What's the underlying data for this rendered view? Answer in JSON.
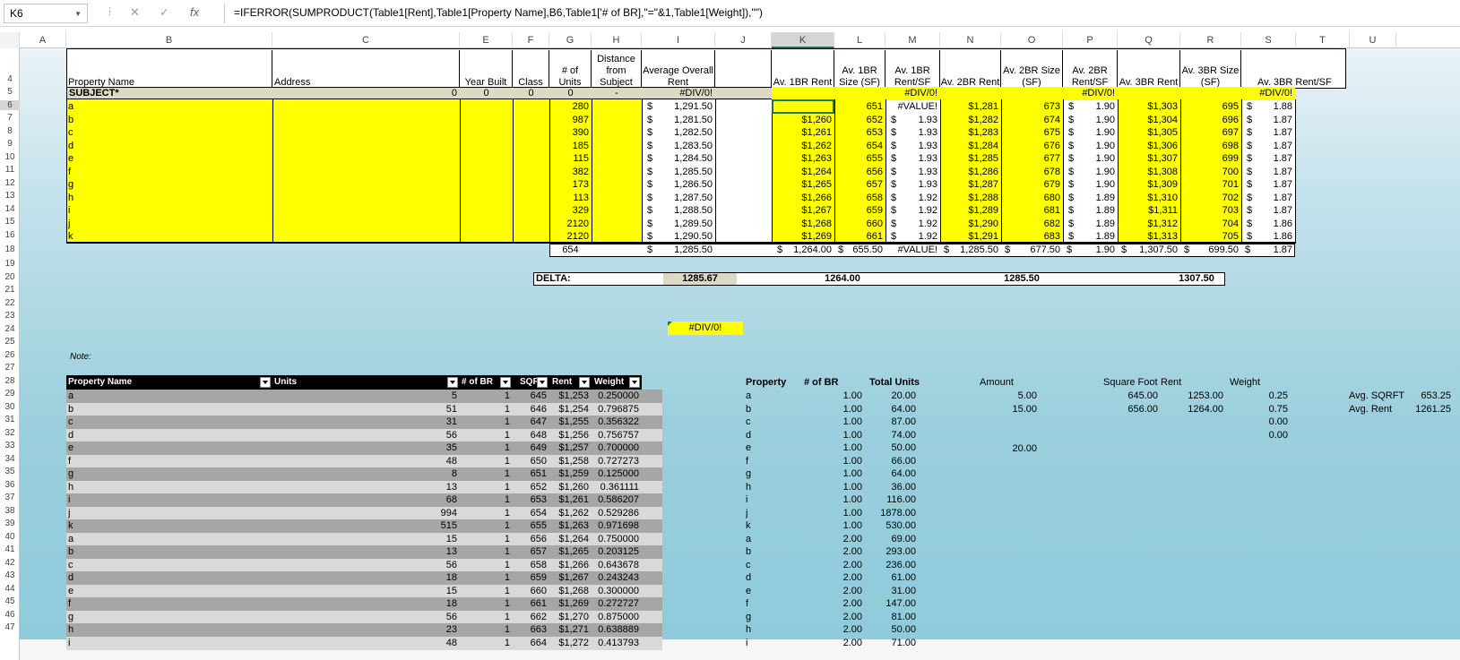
{
  "formula_bar": {
    "name_box": "K6",
    "formula": "=IFERROR(SUMPRODUCT(Table1[Rent],Table1[Property Name],B6,Table1['# of BR],\"=\"&1,Table1[Weight]),\"\")"
  },
  "columns": [
    "A",
    "B",
    "C",
    "E",
    "F",
    "G",
    "H",
    "I",
    "J",
    "K",
    "L",
    "M",
    "N",
    "O",
    "P",
    "Q",
    "R",
    "S",
    "T",
    "U"
  ],
  "row_numbers": [
    "4",
    "5",
    "6",
    "7",
    "8",
    "9",
    "10",
    "11",
    "12",
    "13",
    "14",
    "15",
    "16",
    "18",
    "19",
    "20",
    "21",
    "22",
    "23",
    "24",
    "25",
    "26",
    "27",
    "28",
    "29",
    "30",
    "31",
    "32",
    "33",
    "34",
    "35",
    "36",
    "37",
    "38",
    "39",
    "40",
    "41",
    "42",
    "43",
    "44",
    "45",
    "46",
    "47"
  ],
  "headers": {
    "b": "Property Name",
    "c": "Address",
    "e": "Year Built",
    "f": "Class",
    "g": "# of Units",
    "h": "Distance from Subject",
    "i": "Average Overall Rent",
    "k": "Av. 1BR Rent",
    "l": "Av. 1BR Size (SF)",
    "m": "Av. 1BR Rent/SF",
    "n": "Av. 2BR Rent",
    "o": "Av. 2BR Size (SF)",
    "p": "Av. 2BR Rent/SF",
    "q": "Av. 3BR Rent",
    "r": "Av. 3BR Size (SF)",
    "s": "Av. 3BR Rent/SF"
  },
  "subject": {
    "name": "SUBJECT*",
    "address": "0",
    "year": "0",
    "class": "0",
    "units": "0",
    "distance": "-",
    "avg": "#DIV/0!",
    "m": "#DIV/0!",
    "p": "#DIV/0!",
    "s": "#DIV/0!"
  },
  "comps": [
    {
      "name": "a",
      "units": "280",
      "avg": "1,291.50",
      "k": "",
      "l": "651",
      "m": "#VALUE!",
      "n": "$1,281",
      "o": "673",
      "p": "1.90",
      "q": "$1,303",
      "r": "695",
      "s": "1.88"
    },
    {
      "name": "b",
      "units": "987",
      "avg": "1,281.50",
      "k": "$1,260",
      "l": "652",
      "m": "1.93",
      "n": "$1,282",
      "o": "674",
      "p": "1.90",
      "q": "$1,304",
      "r": "696",
      "s": "1.87"
    },
    {
      "name": "c",
      "units": "390",
      "avg": "1,282.50",
      "k": "$1,261",
      "l": "653",
      "m": "1.93",
      "n": "$1,283",
      "o": "675",
      "p": "1.90",
      "q": "$1,305",
      "r": "697",
      "s": "1.87"
    },
    {
      "name": "d",
      "units": "185",
      "avg": "1,283.50",
      "k": "$1,262",
      "l": "654",
      "m": "1.93",
      "n": "$1,284",
      "o": "676",
      "p": "1.90",
      "q": "$1,306",
      "r": "698",
      "s": "1.87"
    },
    {
      "name": "e",
      "units": "115",
      "avg": "1,284.50",
      "k": "$1,263",
      "l": "655",
      "m": "1.93",
      "n": "$1,285",
      "o": "677",
      "p": "1.90",
      "q": "$1,307",
      "r": "699",
      "s": "1.87"
    },
    {
      "name": "f",
      "units": "382",
      "avg": "1,285.50",
      "k": "$1,264",
      "l": "656",
      "m": "1.93",
      "n": "$1,286",
      "o": "678",
      "p": "1.90",
      "q": "$1,308",
      "r": "700",
      "s": "1.87"
    },
    {
      "name": "g",
      "units": "173",
      "avg": "1,286.50",
      "k": "$1,265",
      "l": "657",
      "m": "1.93",
      "n": "$1,287",
      "o": "679",
      "p": "1.90",
      "q": "$1,309",
      "r": "701",
      "s": "1.87"
    },
    {
      "name": "h",
      "units": "113",
      "avg": "1,287.50",
      "k": "$1,266",
      "l": "658",
      "m": "1.92",
      "n": "$1,288",
      "o": "680",
      "p": "1.89",
      "q": "$1,310",
      "r": "702",
      "s": "1.87"
    },
    {
      "name": "i",
      "units": "329",
      "avg": "1,288.50",
      "k": "$1,267",
      "l": "659",
      "m": "1.92",
      "n": "$1,289",
      "o": "681",
      "p": "1.89",
      "q": "$1,311",
      "r": "703",
      "s": "1.87"
    },
    {
      "name": "j",
      "units": "2120",
      "avg": "1,289.50",
      "k": "$1,268",
      "l": "660",
      "m": "1.92",
      "n": "$1,290",
      "o": "682",
      "p": "1.89",
      "q": "$1,312",
      "r": "704",
      "s": "1.86"
    },
    {
      "name": "k",
      "units": "2120",
      "avg": "1,290.50",
      "k": "$1,269",
      "l": "661",
      "m": "1.92",
      "n": "$1,291",
      "o": "683",
      "p": "1.89",
      "q": "$1,313",
      "r": "705",
      "s": "1.86"
    }
  ],
  "totals": {
    "units": "654",
    "avg": "1,285.50",
    "k": "1,264.00",
    "l": "655.50",
    "m": "#VALUE!",
    "n": "1,285.50",
    "o": "677.50",
    "p": "1.90",
    "q": "1,307.50",
    "r": "699.50",
    "s": "1.87"
  },
  "delta": {
    "label": "DELTA:",
    "i": "1285.67",
    "k": "1264.00",
    "n": "1285.50",
    "q": "1307.50"
  },
  "misc": {
    "err": "#DIV/0!",
    "note": "Note:",
    "dollar": "$"
  },
  "table1": {
    "headers": [
      "Property Name",
      "Units",
      "# of BR",
      "SQFT",
      "Rent",
      "Weight"
    ],
    "rows": [
      [
        "a",
        "5",
        "1",
        "645",
        "$1,253",
        "0.250000"
      ],
      [
        "b",
        "51",
        "1",
        "646",
        "$1,254",
        "0.796875"
      ],
      [
        "c",
        "31",
        "1",
        "647",
        "$1,255",
        "0.356322"
      ],
      [
        "d",
        "56",
        "1",
        "648",
        "$1,256",
        "0.756757"
      ],
      [
        "e",
        "35",
        "1",
        "649",
        "$1,257",
        "0.700000"
      ],
      [
        "f",
        "48",
        "1",
        "650",
        "$1,258",
        "0.727273"
      ],
      [
        "g",
        "8",
        "1",
        "651",
        "$1,259",
        "0.125000"
      ],
      [
        "h",
        "13",
        "1",
        "652",
        "$1,260",
        "0.361111"
      ],
      [
        "i",
        "68",
        "1",
        "653",
        "$1,261",
        "0.586207"
      ],
      [
        "j",
        "994",
        "1",
        "654",
        "$1,262",
        "0.529286"
      ],
      [
        "k",
        "515",
        "1",
        "655",
        "$1,263",
        "0.971698"
      ],
      [
        "a",
        "15",
        "1",
        "656",
        "$1,264",
        "0.750000"
      ],
      [
        "b",
        "13",
        "1",
        "657",
        "$1,265",
        "0.203125"
      ],
      [
        "c",
        "56",
        "1",
        "658",
        "$1,266",
        "0.643678"
      ],
      [
        "d",
        "18",
        "1",
        "659",
        "$1,267",
        "0.243243"
      ],
      [
        "e",
        "15",
        "1",
        "660",
        "$1,268",
        "0.300000"
      ],
      [
        "f",
        "18",
        "1",
        "661",
        "$1,269",
        "0.272727"
      ],
      [
        "g",
        "56",
        "1",
        "662",
        "$1,270",
        "0.875000"
      ],
      [
        "h",
        "23",
        "1",
        "663",
        "$1,271",
        "0.638889"
      ],
      [
        "i",
        "48",
        "1",
        "664",
        "$1,272",
        "0.413793"
      ]
    ]
  },
  "pivot": {
    "headers": [
      "Property",
      "# of BR",
      "Total Units"
    ],
    "rows": [
      [
        "a",
        "1.00",
        "20.00"
      ],
      [
        "b",
        "1.00",
        "64.00"
      ],
      [
        "c",
        "1.00",
        "87.00"
      ],
      [
        "d",
        "1.00",
        "74.00"
      ],
      [
        "e",
        "1.00",
        "50.00"
      ],
      [
        "f",
        "1.00",
        "66.00"
      ],
      [
        "g",
        "1.00",
        "64.00"
      ],
      [
        "h",
        "1.00",
        "36.00"
      ],
      [
        "i",
        "1.00",
        "116.00"
      ],
      [
        "j",
        "1.00",
        "1878.00"
      ],
      [
        "k",
        "1.00",
        "530.00"
      ],
      [
        "a",
        "2.00",
        "69.00"
      ],
      [
        "b",
        "2.00",
        "293.00"
      ],
      [
        "c",
        "2.00",
        "236.00"
      ],
      [
        "d",
        "2.00",
        "61.00"
      ],
      [
        "e",
        "2.00",
        "31.00"
      ],
      [
        "f",
        "2.00",
        "147.00"
      ],
      [
        "g",
        "2.00",
        "81.00"
      ],
      [
        "h",
        "2.00",
        "50.00"
      ],
      [
        "i",
        "2.00",
        "71.00"
      ]
    ]
  },
  "calc": {
    "h_amount": "Amount",
    "h_sqft": "Square Foot",
    "h_rent": "Rent",
    "h_weight": "Weight",
    "amount": [
      "5.00",
      "15.00",
      "",
      "",
      "20.00"
    ],
    "sqft": [
      "645.00",
      "656.00"
    ],
    "rent": [
      "1253.00",
      "1264.00"
    ],
    "weight": [
      "0.25",
      "0.75",
      "0.00",
      "0.00"
    ],
    "avg_sqft_label": "Avg. SQRFT",
    "avg_sqft": "653.25",
    "avg_rent_label": "Avg. Rent",
    "avg_rent": "1261.25"
  }
}
